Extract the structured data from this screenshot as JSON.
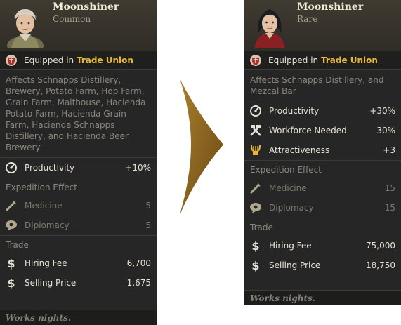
{
  "colors": {
    "panel": "#262626",
    "accent": "#e9b63a",
    "arrow": "#8a6420",
    "muted": "#8c877d"
  },
  "left_card": {
    "name": "Moonshiner",
    "rarity": "Common",
    "portrait": "elderly-worker-portrait",
    "equipped_prefix": "Equipped in",
    "union": "Trade Union",
    "affects": "Affects Schnapps Distillery, Brewery, Potato Farm, Hop Farm, Grain Farm, Malthouse, Hacienda Potato Farm, Hacienda Grain Farm, Hacienda Schnapps Distillery, and Hacienda Beer Brewery",
    "stats": [
      {
        "icon": "productivity-icon",
        "label": "Productivity",
        "value": "+10%"
      }
    ],
    "expedition_title": "Expedition Effect",
    "expedition": [
      {
        "icon": "medicine-icon",
        "label": "Medicine",
        "value": "5"
      },
      {
        "icon": "diplomacy-icon",
        "label": "Diplomacy",
        "value": "5"
      }
    ],
    "trade_title": "Trade",
    "trade": [
      {
        "icon": "dollar-icon",
        "label": "Hiring Fee",
        "value": "6,700"
      },
      {
        "icon": "dollar-icon",
        "label": "Selling Price",
        "value": "1,675"
      }
    ],
    "footer": "Works nights."
  },
  "right_card": {
    "name": "Moonshiner",
    "rarity": "Rare",
    "portrait": "young-woman-portrait",
    "equipped_prefix": "Equipped in",
    "union": "Trade Union",
    "affects": "Affects Schnapps Distillery, and Mezcal Bar",
    "stats": [
      {
        "icon": "productivity-icon",
        "label": "Productivity",
        "value": "+30%"
      },
      {
        "icon": "workforce-icon",
        "label": "Workforce Needed",
        "value": "-30%"
      },
      {
        "icon": "attractiveness-icon",
        "label": "Attractiveness",
        "value": "+3"
      }
    ],
    "expedition_title": "Expedition Effect",
    "expedition": [
      {
        "icon": "medicine-icon",
        "label": "Medicine",
        "value": "15"
      },
      {
        "icon": "diplomacy-icon",
        "label": "Diplomacy",
        "value": "15"
      }
    ],
    "trade_title": "Trade",
    "trade": [
      {
        "icon": "dollar-icon",
        "label": "Hiring Fee",
        "value": "75,000"
      },
      {
        "icon": "dollar-icon",
        "label": "Selling Price",
        "value": "18,750"
      }
    ],
    "footer": "Works nights."
  }
}
